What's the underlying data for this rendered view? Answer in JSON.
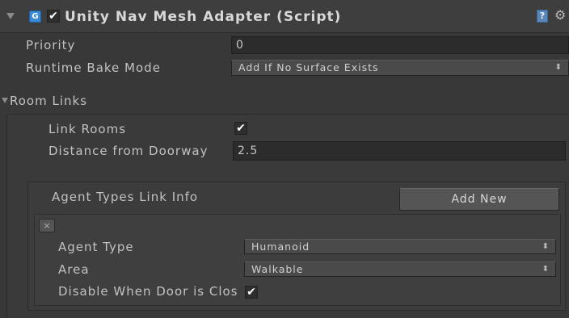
{
  "component": {
    "title": "Unity Nav Mesh Adapter (Script)",
    "enabled_check": "✔",
    "script_icon_glyph": "G",
    "help_glyph": "?",
    "settings_glyph": "⚙"
  },
  "fields": {
    "priority": {
      "label": "Priority",
      "value": "0"
    },
    "runtime_bake_mode": {
      "label": "Runtime Bake Mode",
      "value": "Add If No Surface Exists"
    }
  },
  "room_links": {
    "label": "Room Links",
    "link_rooms": {
      "label": "Link Rooms",
      "check": "✔"
    },
    "distance_from_doorway": {
      "label": "Distance from Doorway",
      "value": "2.5"
    },
    "agent_types": {
      "label": "Agent Types Link Info",
      "add_button": "Add New",
      "remove_glyph": "×",
      "entry": {
        "agent_type": {
          "label": "Agent Type",
          "value": "Humanoid"
        },
        "area": {
          "label": "Area",
          "value": "Walkable"
        },
        "disable_when_closed": {
          "label": "Disable When Door is Clos",
          "check": "✔"
        }
      }
    }
  },
  "dropdown_arrows": "⬍",
  "colors": {
    "background": "#383838",
    "header": "#3e3e3e",
    "field": "#2c2c2c",
    "button": "#555555",
    "script_icon": "#3a8ad8"
  }
}
